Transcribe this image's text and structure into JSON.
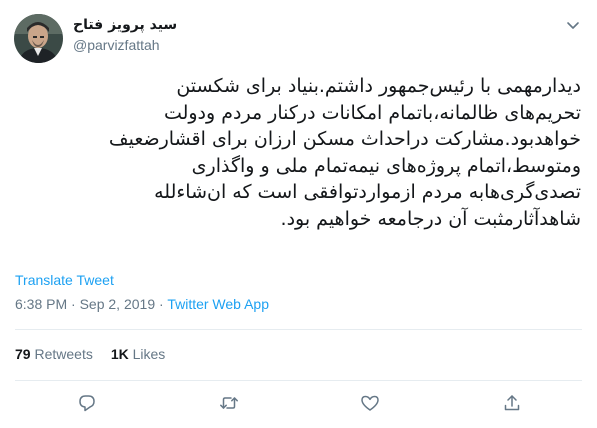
{
  "tweet": {
    "author": {
      "display_name": "سید پرویز فتاح",
      "handle": "@parvizfattah"
    },
    "text_lines": [
      "دیدارمهمی با رئیس‌جمهور داشتم.بنیاد برای شکستن",
      "تحریم‌های ظالمانه،باتمام امکانات درکنار مردم ودولت",
      "خواهدبود.مشارکت دراحداث مسکن ارزان برای اقشارضعیف",
      "ومتوسط،اتمام پروژه‌های نیمه‌تمام ملی و واگذاری",
      "تصدی‌گری‌هابه مردم ازمواردتوافقی است که ان‌شاءلله",
      "شاهدآثارمثبت آن درجامعه خواهیم بود."
    ],
    "translate_label": "Translate Tweet",
    "time": "6:38 PM",
    "date": "Sep 2, 2019",
    "separator": "·",
    "source": "Twitter Web App",
    "retweets_count": "79",
    "retweets_label": "Retweets",
    "likes_count": "1K",
    "likes_label": "Likes"
  },
  "actions": {
    "reply_icon": "reply-icon",
    "retweet_icon": "retweet-icon",
    "like_icon": "heart-icon",
    "share_icon": "share-icon"
  },
  "colors": {
    "link": "#1da1f2",
    "secondary": "#657786",
    "primary_text": "#14171a",
    "divider": "#e6ecf0"
  }
}
